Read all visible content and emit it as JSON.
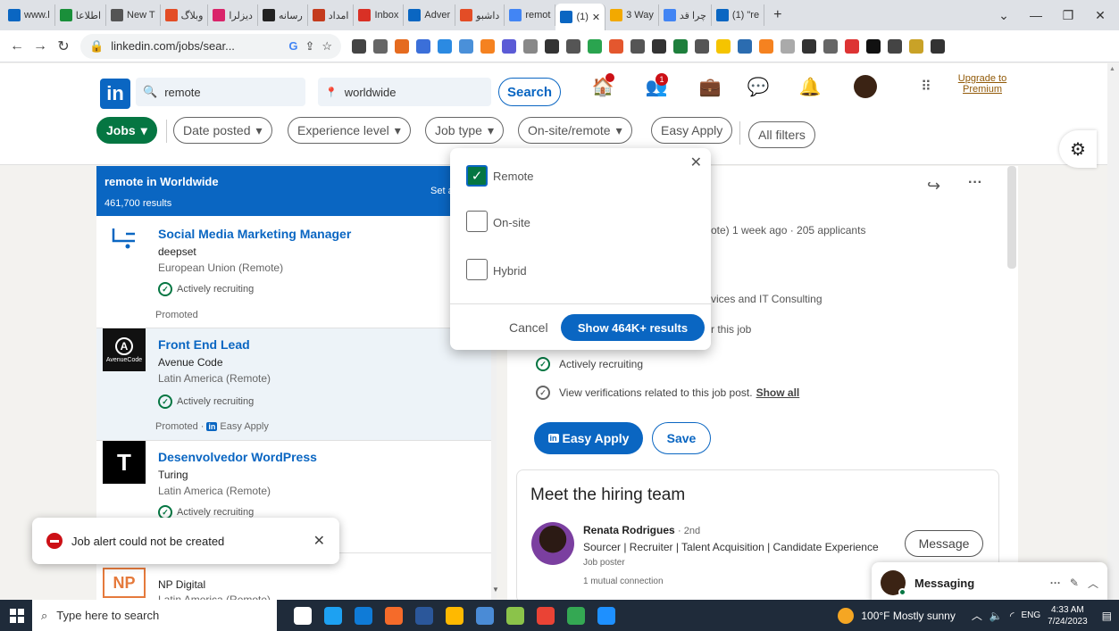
{
  "browser": {
    "tabs": [
      {
        "label": "www.l",
        "color": "#0a66c2",
        "icon": "linkedin-icon"
      },
      {
        "label": "اطلاعا",
        "color": "#1a8f3a",
        "icon": "tab-icon"
      },
      {
        "label": "New T",
        "color": "#555555",
        "icon": "chatgpt-icon"
      },
      {
        "label": "وبلاگ",
        "color": "#e34d26",
        "icon": "tab-icon"
      },
      {
        "label": "دیزلرا",
        "color": "#d9246a",
        "icon": "tab-icon"
      },
      {
        "label": "رسانه",
        "color": "#222222",
        "icon": "tab-icon"
      },
      {
        "label": "امداد",
        "color": "#c43b1d",
        "icon": "tab-icon"
      },
      {
        "label": "Inbox",
        "color": "#d93025",
        "icon": "gmail-icon"
      },
      {
        "label": "Adver",
        "color": "#0a66c2",
        "icon": "linkedin-icon"
      },
      {
        "label": "داشبو",
        "color": "#e34d26",
        "icon": "tab-icon"
      },
      {
        "label": "remot",
        "color": "#4285f4",
        "icon": "google-icon"
      },
      {
        "label": "(1)",
        "color": "#0a66c2",
        "icon": "linkedin-icon",
        "active": true
      },
      {
        "label": "3 Way",
        "color": "#f2a900",
        "icon": "tab-icon"
      },
      {
        "label": "چرا قد",
        "color": "#4285f4",
        "icon": "google-icon"
      },
      {
        "label": "(1) \"re",
        "color": "#0a66c2",
        "icon": "linkedin-icon"
      }
    ],
    "new_tab": "+",
    "url": "linkedin.com/jobs/sear..."
  },
  "header": {
    "search_keyword": "remote",
    "search_location": "worldwide",
    "search_button": "Search",
    "home_badge": "",
    "network_badge": "1",
    "upgrade_line1": "Upgrade to",
    "upgrade_line2": "Premium"
  },
  "filters": {
    "jobs": "Jobs",
    "date_posted": "Date posted",
    "experience": "Experience level",
    "job_type": "Job type",
    "onsite": "On-site/remote",
    "easy_apply": "Easy Apply",
    "all_filters": "All filters"
  },
  "list": {
    "title": "remote in Worldwide",
    "count": "461,700 results",
    "set_alert": "Set aler",
    "jobs": [
      {
        "title": "Social Media Marketing Manager",
        "company": "deepset",
        "location": "European Union (Remote)",
        "recruiting": "Actively recruiting",
        "promo": "Promoted"
      },
      {
        "title": "Front End Lead",
        "company": "Avenue Code",
        "location": "Latin America (Remote)",
        "recruiting": "Actively recruiting",
        "promo": "Promoted ·",
        "easy": "Easy Apply",
        "logo_text": "AvenueCode"
      },
      {
        "title": "Desenvolvedor WordPress",
        "company": "Turing",
        "location": "Latin America (Remote)",
        "recruiting": "Actively recruiting"
      },
      {
        "title": "",
        "company": "NP Digital",
        "location": "Latin America (Remote)",
        "logo_text": "NP"
      }
    ]
  },
  "dropdown": {
    "options": [
      {
        "label": "Remote",
        "checked": true
      },
      {
        "label": "On-site",
        "checked": false
      },
      {
        "label": "Hybrid",
        "checked": false
      }
    ],
    "cancel": "Cancel",
    "show": "Show 464K+ results"
  },
  "detail": {
    "meta": "ote)  1 week ago  · 205 applicants",
    "industry": "vices and IT Consulting",
    "match": "r this job",
    "recruiting": "Actively recruiting",
    "verify": "View verifications related to this job post.",
    "show_all": "Show all",
    "easy_apply": "Easy Apply",
    "save": "Save",
    "hiring_title": "Meet the hiring team",
    "person_name": "Renata Rodrigues",
    "person_degree": "· 2nd",
    "person_title": "Sourcer | Recruiter | Talent Acquisition | Candidate Experience",
    "person_role": "Job poster",
    "mutual": "1 mutual connection",
    "message": "Message"
  },
  "toast": {
    "text": "Job alert could not be created"
  },
  "messaging": {
    "label": "Messaging"
  },
  "taskbar": {
    "search": "Type here to search",
    "weather": "100°F  Mostly sunny",
    "lang": "ENG",
    "time": "4:33 AM",
    "date": "7/24/2023"
  }
}
